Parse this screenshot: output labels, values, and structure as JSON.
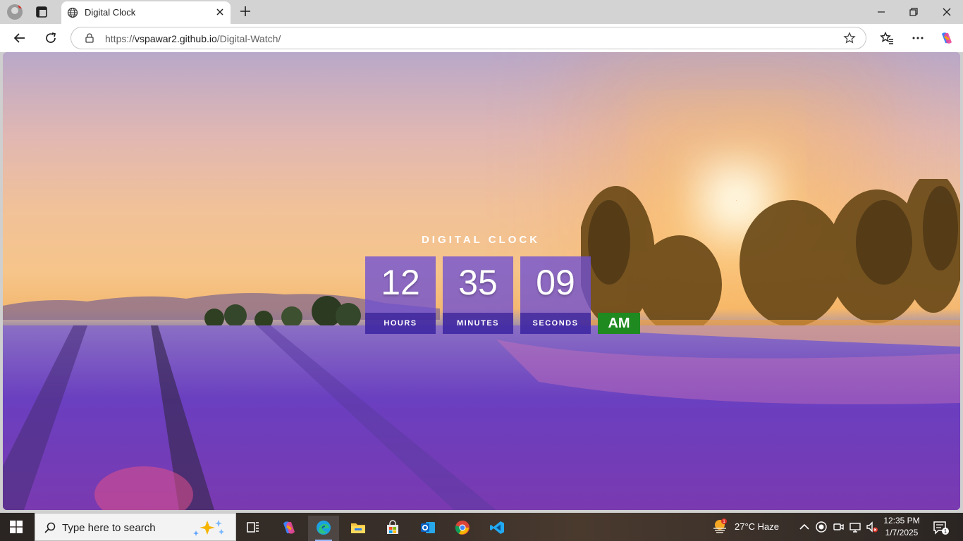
{
  "browser": {
    "tab_title": "Digital Clock",
    "url_prefix": "https://",
    "url_host": "vspawar2.github.io",
    "url_path": "/Digital-Watch/"
  },
  "page": {
    "heading": "DIGITAL CLOCK",
    "hours_value": "12",
    "hours_label": "HOURS",
    "minutes_value": "35",
    "minutes_label": "MINUTES",
    "seconds_value": "09",
    "seconds_label": "SECONDS",
    "meridiem": "AM",
    "colors": {
      "unit_box": "#6e50d2",
      "unit_label_band": "#28148c",
      "meridiem_box": "#1f8a1f"
    }
  },
  "taskbar": {
    "search_placeholder": "Type here to search",
    "weather_text": "27°C  Haze",
    "weather_badge": "1",
    "time": "12:35 PM",
    "date": "1/7/2025",
    "notification_count": "1",
    "apps": [
      "task-view-icon",
      "copilot-icon",
      "edge-icon",
      "file-explorer-icon",
      "store-icon",
      "outlook-icon",
      "chrome-icon",
      "vscode-icon"
    ]
  }
}
